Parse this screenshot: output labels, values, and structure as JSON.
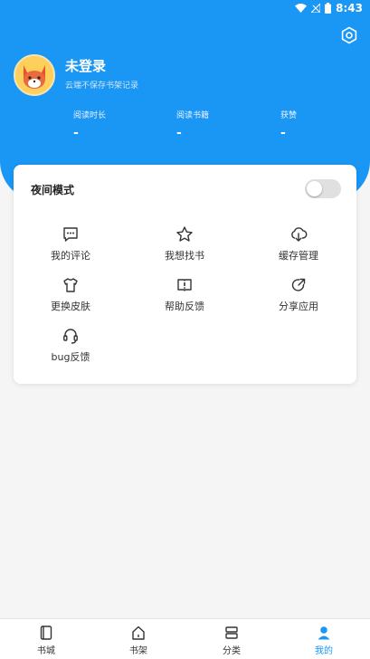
{
  "status_bar": {
    "time": "8:43"
  },
  "profile": {
    "name": "未登录",
    "subtitle": "云端不保存书架记录"
  },
  "stats": [
    {
      "label": "阅读时长",
      "value": "-"
    },
    {
      "label": "阅读书籍",
      "value": "-"
    },
    {
      "label": "获赞",
      "value": "-"
    }
  ],
  "night_mode": {
    "label": "夜间模式",
    "enabled": false
  },
  "menu": [
    {
      "label": "我的评论",
      "icon": "comment-icon"
    },
    {
      "label": "我想找书",
      "icon": "star-icon"
    },
    {
      "label": "缓存管理",
      "icon": "cloud-download-icon"
    },
    {
      "label": "更换皮肤",
      "icon": "shirt-icon"
    },
    {
      "label": "帮助反馈",
      "icon": "feedback-book-icon"
    },
    {
      "label": "分享应用",
      "icon": "share-icon"
    },
    {
      "label": "bug反馈",
      "icon": "headset-icon"
    }
  ],
  "bottom_nav": [
    {
      "label": "书城",
      "icon": "bookstore-icon",
      "active": false
    },
    {
      "label": "书架",
      "icon": "bookshelf-icon",
      "active": false
    },
    {
      "label": "分类",
      "icon": "category-icon",
      "active": false
    },
    {
      "label": "我的",
      "icon": "profile-icon",
      "active": true
    }
  ],
  "colors": {
    "primary": "#1a96f5",
    "background": "#f5f5f5"
  }
}
